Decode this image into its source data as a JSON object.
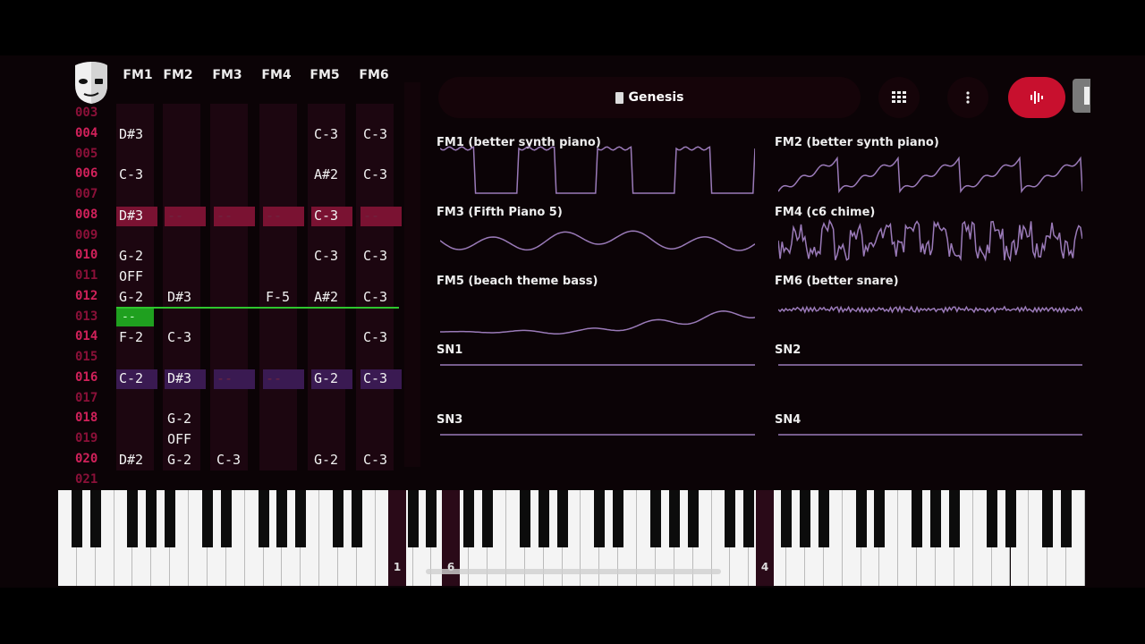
{
  "song": {
    "title": "Genesis"
  },
  "channels": [
    "FM1",
    "FM2",
    "FM3",
    "FM4",
    "FM5",
    "FM6"
  ],
  "rows": [
    {
      "num": "003",
      "cells": [
        "",
        "",
        "",
        "",
        "",
        ""
      ]
    },
    {
      "num": "004",
      "cells": [
        "D#3",
        "",
        "",
        "",
        "C-3",
        "C-3"
      ]
    },
    {
      "num": "005",
      "cells": [
        "",
        "",
        "",
        "",
        "",
        ""
      ]
    },
    {
      "num": "006",
      "cells": [
        "C-3",
        "",
        "",
        "",
        "A#2",
        "C-3"
      ]
    },
    {
      "num": "007",
      "cells": [
        "",
        "",
        "",
        "",
        "",
        ""
      ]
    },
    {
      "num": "008",
      "cells": [
        "D#3",
        "--",
        "--",
        "--",
        "C-3",
        "--"
      ],
      "highlight": "red"
    },
    {
      "num": "009",
      "cells": [
        "",
        "",
        "",
        "",
        "",
        ""
      ]
    },
    {
      "num": "010",
      "cells": [
        "G-2",
        "",
        "",
        "",
        "C-3",
        "C-3"
      ]
    },
    {
      "num": "011",
      "cells": [
        "OFF",
        "",
        "",
        "",
        "",
        ""
      ]
    },
    {
      "num": "012",
      "cells": [
        "G-2",
        "D#3",
        "",
        "F-5",
        "A#2",
        "C-3"
      ]
    },
    {
      "num": "013",
      "cells": [
        "--",
        "",
        "",
        "",
        "",
        ""
      ],
      "cursor": true
    },
    {
      "num": "014",
      "cells": [
        "F-2",
        "C-3",
        "",
        "",
        "",
        "C-3"
      ]
    },
    {
      "num": "015",
      "cells": [
        "",
        "",
        "",
        "",
        "",
        ""
      ]
    },
    {
      "num": "016",
      "cells": [
        "C-2",
        "D#3",
        "--",
        "--",
        "G-2",
        "C-3"
      ],
      "highlight": "purple"
    },
    {
      "num": "017",
      "cells": [
        "",
        "",
        "",
        "",
        "",
        ""
      ]
    },
    {
      "num": "018",
      "cells": [
        "",
        "G-2",
        "",
        "",
        "",
        ""
      ]
    },
    {
      "num": "019",
      "cells": [
        "",
        "OFF",
        "",
        "",
        "",
        ""
      ]
    },
    {
      "num": "020",
      "cells": [
        "D#2",
        "G-2",
        "C-3",
        "",
        "G-2",
        "C-3"
      ]
    },
    {
      "num": "021",
      "cells": [
        "",
        "",
        "",
        "",
        "",
        ""
      ]
    }
  ],
  "scopes": [
    {
      "label": "FM1 (better synth piano)",
      "wave": "square"
    },
    {
      "label": "FM2 (better synth piano)",
      "wave": "saw"
    },
    {
      "label": "FM3 (Fifth Piano 5)",
      "wave": "soft"
    },
    {
      "label": "FM4 (c6 chime)",
      "wave": "noise"
    },
    {
      "label": "FM5 (beach theme bass)",
      "wave": "rise"
    },
    {
      "label": "FM6 (better snare)",
      "wave": "hiss"
    },
    {
      "label": "SN1",
      "wave": "flat"
    },
    {
      "label": "SN2",
      "wave": "flat"
    },
    {
      "label": "SN3",
      "wave": "flat"
    },
    {
      "label": "SN4",
      "wave": "flat"
    }
  ],
  "keyboard": {
    "markers": [
      "1",
      "6",
      "4"
    ]
  },
  "colors": {
    "accent": "#c8102e",
    "scope": "#9a7ab8",
    "rownum": "#d0215a",
    "cursor": "#2ec62e"
  },
  "icons": {
    "song": "song-file-icon",
    "grid": "grid-icon",
    "menu": "more-vertical-icon",
    "record": "waveform-icon"
  }
}
